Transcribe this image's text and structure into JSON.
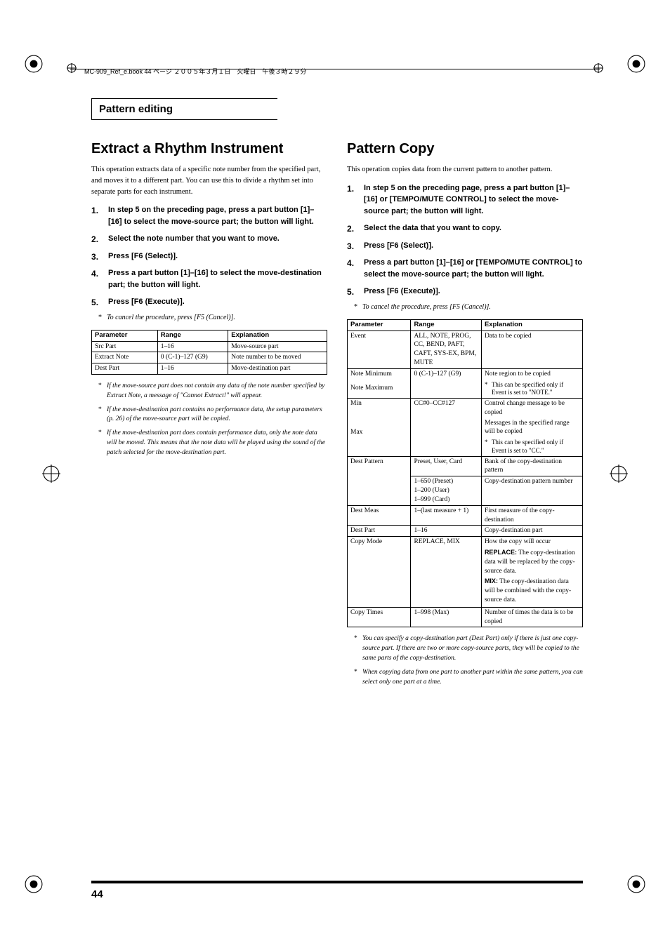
{
  "running_head": "MC-909_Ref_e.book  44 ページ  ２００５年３月１日　火曜日　午後３時２９分",
  "section_header": "Pattern editing",
  "page_number": "44",
  "left": {
    "title": "Extract a Rhythm Instrument",
    "intro": "This operation extracts data of a specific note number from the specified part, and moves it to a different part. You can use this to divide a rhythm set into separate parts for each instrument.",
    "steps": [
      "In step 5 on the preceding page, press a part button [1]–[16] to select the move-source part; the button will light.",
      "Select the note number that you want to move.",
      "Press [F6 (Select)].",
      "Press a part button [1]–[16] to select the move-destination part; the button will light.",
      "Press [F6 (Execute)]."
    ],
    "cancel": "To cancel the procedure, press [F5 (Cancel)].",
    "table": {
      "headers": {
        "parameter": "Parameter",
        "range": "Range",
        "explanation": "Explanation"
      },
      "rows": [
        {
          "parameter": "Src Part",
          "range": "1–16",
          "explanation": "Move-source part"
        },
        {
          "parameter": "Extract Note",
          "range": "0 (C-1)–127 (G9)",
          "explanation": "Note number to be moved"
        },
        {
          "parameter": "Dest Part",
          "range": "1–16",
          "explanation": "Move-destination part"
        }
      ]
    },
    "footnotes": [
      "If the move-source part does not contain any data of the note number specified by Extract Note, a message of \"Cannot Extract!\" will appear.",
      "If the move-destination part contains no performance data, the setup parameters (p. 26) of the move-source part will be copied.",
      "If the move-destination part does contain performance data, only the note data will be moved. This means that the note data will be played using the sound of the patch selected for the move-destination part."
    ]
  },
  "right": {
    "title": "Pattern Copy",
    "intro": "This operation copies data from the current pattern to another pattern.",
    "steps": [
      "In step 5 on the preceding page, press a part button [1]–[16] or [TEMPO/MUTE CONTROL] to select the move-source part; the button will light.",
      "Select the data that you want to copy.",
      "Press [F6 (Select)].",
      "Press a part button [1]–[16] or [TEMPO/MUTE CONTROL] to select the move-source part; the button will light.",
      "Press [F6 (Execute)]."
    ],
    "cancel": "To cancel the procedure, press [F5 (Cancel)].",
    "table": {
      "headers": {
        "parameter": "Parameter",
        "range": "Range",
        "explanation": "Explanation"
      },
      "rows": {
        "event": {
          "parameter": "Event",
          "range": "ALL, NOTE, PROG, CC, BEND, PAFT, CAFT, SYS-EX, BPM, MUTE",
          "explanation": "Data to be copied"
        },
        "noteMin": {
          "parameter": "Note Minimum",
          "range": "0 (C-1)–127 (G9)"
        },
        "noteMax": {
          "parameter": "Note Maximum",
          "explain1": "Note region to be copied",
          "note": "This can be specified only if Event is set to \"NOTE.\""
        },
        "min": {
          "parameter": "Min",
          "range": "CC#0–CC#127"
        },
        "max": {
          "parameter": "Max",
          "explain1": "Control change message to be copied",
          "explain2": "Messages in the specified range will be copied",
          "note": "This can be specified only if Event is set to \"CC.\""
        },
        "destPattern": {
          "parameter": "Dest Pattern",
          "range1": "Preset, User, Card",
          "explain1": "Bank of the copy-destination pattern",
          "range2a": "1–650 (Preset)",
          "range2b": "1–200 (User)",
          "range2c": "1–999 (Card)",
          "explain2": "Copy-destination pattern number"
        },
        "destMeas": {
          "parameter": "Dest Meas",
          "range": "1–(last measure + 1)",
          "explanation": "First measure of the copy-destination"
        },
        "destPart": {
          "parameter": "Dest Part",
          "range": "1–16",
          "explanation": "Copy-destination part"
        },
        "copyMode": {
          "parameter": "Copy Mode",
          "range": "REPLACE, MIX",
          "explain_intro": "How the copy will occur",
          "replace_label": "REPLACE:",
          "replace_text": " The copy-destination data will be replaced by the copy-source data.",
          "mix_label": "MIX:",
          "mix_text": " The copy-destination data will be combined with the copy-source data."
        },
        "copyTimes": {
          "parameter": "Copy Times",
          "range": "1–998 (Max)",
          "explanation": "Number of times the data is to be copied"
        }
      }
    },
    "footnotes": [
      "You can specify a copy-destination part (Dest Part) only if there is just one copy-source part. If there are two or more copy-source parts, they will be copied to the same parts of the copy-destination.",
      "When copying data from one part to another part within the same pattern, you can select only one part at a time."
    ]
  }
}
